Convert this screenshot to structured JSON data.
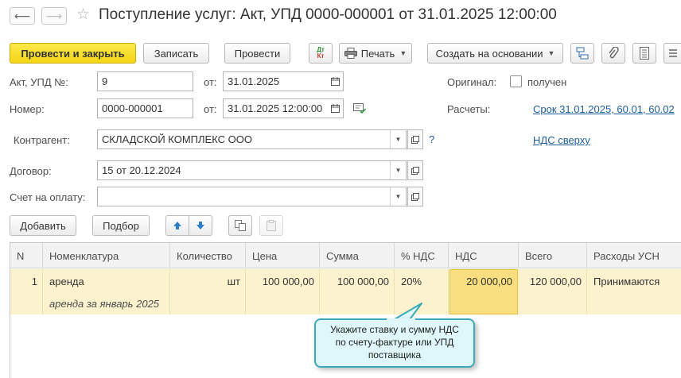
{
  "window": {
    "title": "Поступление услуг: Акт, УПД 0000-000001 от 31.01.2025 12:00:00",
    "back_glyph": "⟵",
    "forward_glyph": "⟶",
    "star_glyph": "☆"
  },
  "toolbar": {
    "post_and_close": "Провести и закрыть",
    "write": "Записать",
    "post": "Провести",
    "dtkt_top": "Дт",
    "dtkt_bottom": "Кт",
    "print": "Печать",
    "create_based_on": "Создать на основании",
    "dropdown_glyph": "▼"
  },
  "form": {
    "doc_no_label": "Акт, УПД №:",
    "doc_no_value": "9",
    "from_label": "от:",
    "doc_date_value": "31.01.2025",
    "number_label": "Номер:",
    "number_value": "0000-000001",
    "from_label_2": "от:",
    "number_date_value": "31.01.2025 12:00:00",
    "original_label": "Оригинал:",
    "received_label": "получен",
    "received_checked": false,
    "settlements_label": "Расчеты:",
    "settlements_link": "Срок 31.01.2025, 60.01, 60.02",
    "counterparty_label": "Контрагент:",
    "counterparty_value": "СКЛАДСКОЙ КОМПЛЕКС ООО",
    "help_glyph": "?",
    "vat_link": "НДС сверху",
    "contract_label": "Договор:",
    "contract_value": "15 от 20.12.2024",
    "invoice_label": "Счет на оплату:",
    "invoice_value": ""
  },
  "table_toolbar": {
    "add": "Добавить",
    "pick": "Подбор"
  },
  "table": {
    "headers": [
      "N",
      "Номенклатура",
      "Количество",
      "Цена",
      "Сумма",
      "% НДС",
      "НДС",
      "Всего",
      "Расходы УСН"
    ],
    "rows": [
      {
        "n": "1",
        "item": "аренда",
        "item_content": "аренда за январь 2025",
        "qty": "",
        "unit": "шт",
        "price": "100 000,00",
        "sum": "100 000,00",
        "vat_rate": "20%",
        "vat": "20 000,00",
        "total": "120 000,00",
        "usn_expenses": "Принимаются"
      }
    ]
  },
  "callout": {
    "line1": "Укажите ставку и сумму НДС",
    "line2": "по счету-фактуре или УПД",
    "line3": "поставщика"
  },
  "colors": {
    "primary_button": "#f4d515",
    "link": "#1d5d9b",
    "selected_row": "#fcf3ce",
    "active_cell": "#f8de7e",
    "callout_border": "#3aaab8",
    "callout_bg": "#dff6fb"
  }
}
